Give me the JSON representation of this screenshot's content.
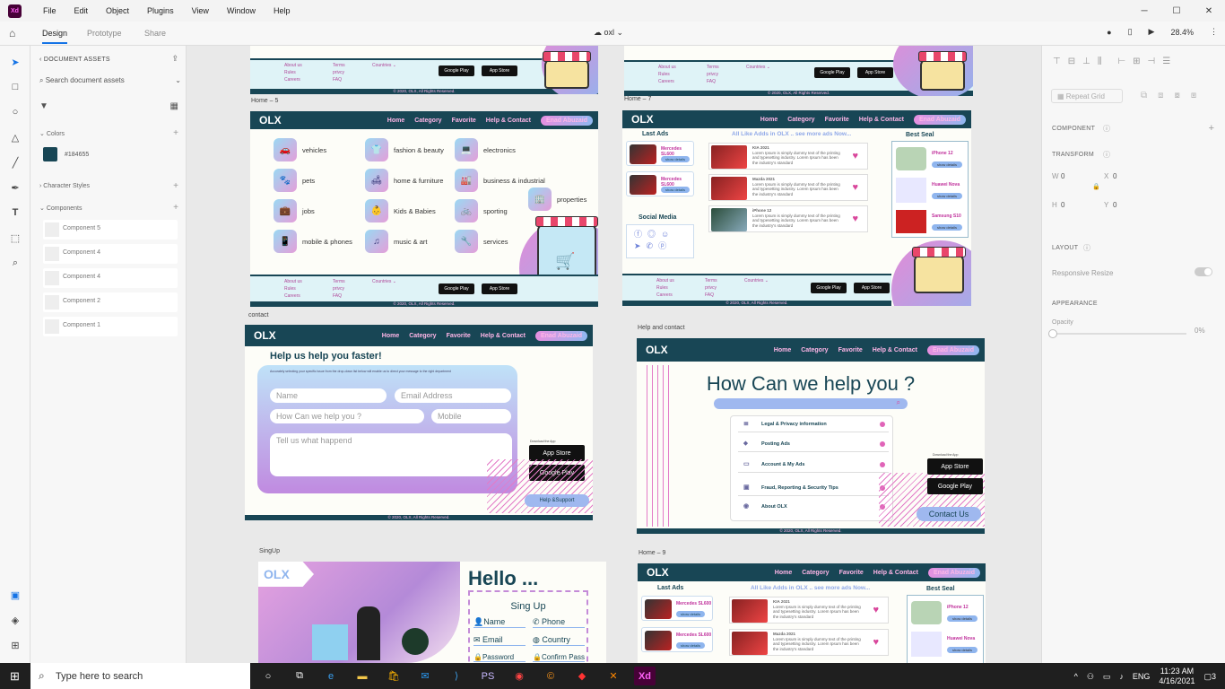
{
  "menubar": {
    "logo": "Xd",
    "items": [
      "File",
      "Edit",
      "Object",
      "Plugins",
      "View",
      "Window",
      "Help"
    ],
    "win_min": "─",
    "win_max": "☐",
    "win_close": "✕"
  },
  "toolbar": {
    "tabs": [
      "Design",
      "Prototype",
      "Share"
    ],
    "doc_name": "oxl",
    "zoom": "28.4%"
  },
  "assets": {
    "header": "DOCUMENT ASSETS",
    "search_placeholder": "Search document assets",
    "colors_label": "Colors",
    "color_value": "#184655",
    "char_styles_label": "Character Styles",
    "components_label": "Components",
    "components": [
      "Component 5",
      "Component 4",
      "Component 4",
      "Component 2",
      "Component 1"
    ]
  },
  "props": {
    "repeat_grid": "Repeat Grid",
    "component": "COMPONENT",
    "transform": "TRANSFORM",
    "w": "W",
    "w_val": "0",
    "x": "X",
    "x_val": "0",
    "h": "H",
    "h_val": "0",
    "y": "Y",
    "y_val": "0",
    "layout": "LAYOUT",
    "responsive": "Responsive Resize",
    "appearance": "APPEARANCE",
    "opacity": "Opacity",
    "opacity_val": "0%"
  },
  "taskbar": {
    "search": "Type here to search",
    "lang": "ENG",
    "time": "11:23 AM",
    "date": "4/16/2021",
    "notif": "3"
  },
  "site": {
    "logo": "OLX",
    "nav": [
      "Home",
      "Category",
      "Favorite",
      "Help & Contact"
    ],
    "user": "Enad Abuzaid",
    "copyright": "© 2020, OLX, All Rights Reserved.",
    "foot_links1": [
      "About us",
      "Rules",
      "Careers"
    ],
    "foot_links2": [
      "Terms",
      "privcy",
      "FAQ"
    ],
    "countries": "Countries",
    "google_play": "Google Play",
    "app_store": "App Store"
  },
  "artboards": {
    "home5": "Home – 5",
    "home7": "Home – 7",
    "contact": "contact",
    "help": "Help and contact",
    "signup": "SingUp",
    "home9": "Home – 9"
  },
  "categories": [
    "vehicles",
    "fashion & beauty",
    "electronics",
    "pets",
    "home & furniture",
    "business & industrial",
    "properties",
    "jobs",
    "Kids & Babies",
    "sporting",
    "mobile & phones",
    "music & art",
    "services"
  ],
  "home7": {
    "last_ads": "Last Ads",
    "all_like": "All Like Adds in OLX .. see more ads Now...",
    "best_seal": "Best Seal",
    "social": "Social Media",
    "show": "show details",
    "cars": [
      "Mercedes SL600",
      "Mercedes SL600"
    ],
    "phones": [
      "iPhone 12",
      "Huawei Nova",
      "Samsung S10"
    ],
    "ads": [
      "KIA 2021",
      "Mazda 2021",
      "iPhone 12"
    ],
    "ad_text": "Lorem Ipsum is simply dummy text of the printing and typesetting industry. Lorem Ipsum has been the industry's standard"
  },
  "contact": {
    "title": "Help us help you faster!",
    "intro": "Accurately selecting your specific issue from the drop-down list below will enable us to direct your message to the right department",
    "name": "Name",
    "email": "Email Address",
    "how": "How Can we help you ?",
    "mobile": "Mobile",
    "tell": "Tell us what happend",
    "download": "Download the App",
    "help_support": "Help &Support"
  },
  "help": {
    "title": "How Can we help you ?",
    "items": [
      "Legal & Privacy information",
      "Posting Ads",
      "Account & My Ads",
      "Fraud, Reporting & Security Tips",
      "About OLX"
    ],
    "contact_us": "Contact Us"
  },
  "signup": {
    "hello": "Hello ...",
    "title": "Sing Up",
    "fields": [
      "Name",
      "Phone",
      "Email",
      "Country",
      "Password",
      "Confirm Pass"
    ]
  }
}
